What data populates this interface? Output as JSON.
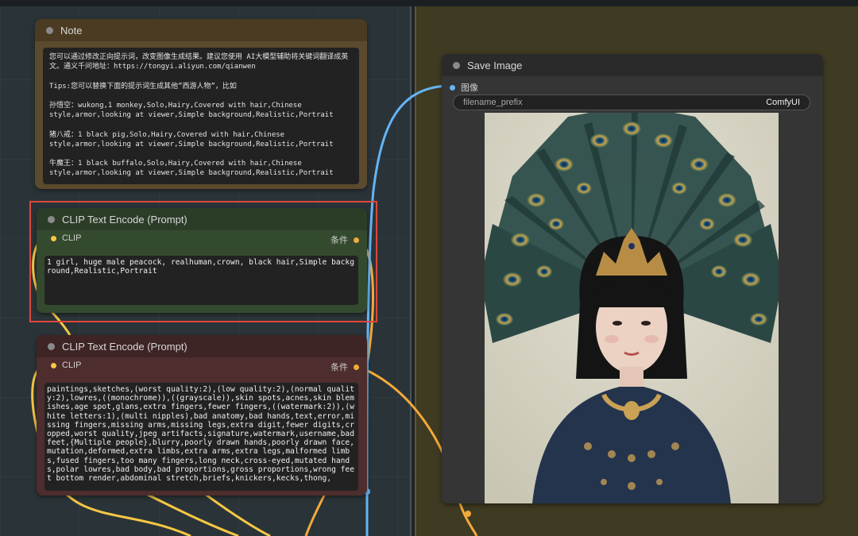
{
  "note": {
    "title": "Note",
    "body": "您可以通过修改正向提示词，改变图像生成结果。建议您使用 AI大模型辅助将关键词翻译成英文。通义千问地址：https://tongyi.aliyun.com/qianwen\n\nTips:您可以替换下面的提示词生成其他”西游人物”，比如\n\n孙悟空：wukong,1 monkey,Solo,Hairy,Covered with hair,Chinese style,armor,looking at viewer,Simple background,Realistic,Portrait\n\n猪八戒：1 black pig,Solo,Hairy,Covered with hair,Chinese style,armor,looking at viewer,Simple background,Realistic,Portrait\n\n牛魔王：1 black buffalo,Solo,Hairy,Covered with hair,Chinese style,armor,looking at viewer,Simple background,Realistic,Portrait"
  },
  "clip_positive": {
    "title": "CLIP Text Encode (Prompt)",
    "input_label": "CLIP",
    "output_label": "条件",
    "text": "1 girl, huge male peacock, realhuman,crown, black hair,Simple background,Realistic,Portrait"
  },
  "clip_negative": {
    "title": "CLIP Text Encode (Prompt)",
    "input_label": "CLIP",
    "output_label": "条件",
    "text": "paintings,sketches,(worst quality:2),(low quality:2),(normal quality:2),lowres,((monochrome)),((grayscale)),skin spots,acnes,skin blemishes,age spot,glans,extra fingers,fewer fingers,((watermark:2)),(white letters:1),(multi nipples),bad anatomy,bad hands,text,error,missing fingers,missing arms,missing legs,extra digit,fewer digits,cropped,worst quality,jpeg artifacts,signature,watermark,username,bad feet,{Multiple people},blurry,poorly drawn hands,poorly drawn face,mutation,deformed,extra limbs,extra arms,extra legs,malformed limbs,fused fingers,too many fingers,long neck,cross-eyed,mutated hands,polar lowres,bad body,bad proportions,gross proportions,wrong feet bottom render,abdominal stretch,briefs,knickers,kecks,thong,"
  },
  "save_image": {
    "title": "Save Image",
    "input_label": "图像",
    "widget_label": "filename_prefix",
    "widget_value": "ComfyUI"
  },
  "colors": {
    "left_group": "#2a3438",
    "right_group": "#3f3a22",
    "highlight": "#e0473c",
    "wire_clip": "#f6c744",
    "wire_cond": "#f3a93b",
    "wire_image": "#64b5f6"
  }
}
